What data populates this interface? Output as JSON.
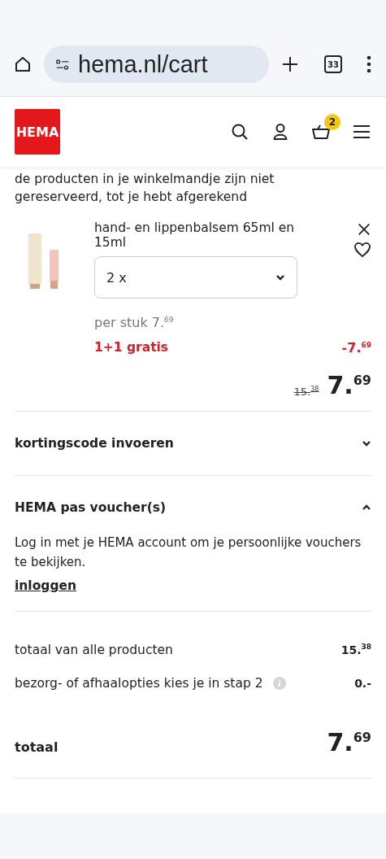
{
  "browser": {
    "url": "hema.nl/cart",
    "tab_count": "33"
  },
  "header": {
    "logo": "HEMA",
    "cart_count": "2"
  },
  "notice": "de producten in je winkelmandje zijn niet gereserveerd, tot je hebt afgerekend",
  "product": {
    "name": "hand- en lippenbalsem 65ml en 15ml",
    "quantity": "2 x",
    "unit_price": "per stuk 7.$^{69}$",
    "promo": "1+1 gratis",
    "discount": "-7.$^{69}$",
    "old_price": "15.$^{38}$",
    "price": "7.$^{69}$"
  },
  "sections": [
    {
      "title": "kortingscode invoeren",
      "expanded": false
    },
    {
      "title": "HEMA pas voucher(s)",
      "expanded": true,
      "text": "Log in met je HEMA account om je persoonlijke vouchers te bekijken.",
      "link": "inloggen"
    }
  ],
  "summary": [
    {
      "label": "totaal van alle producten",
      "value": "15.$^{38}$",
      "info": false
    },
    {
      "label": "bezorg- of afhaalopties kies je in stap 2",
      "value": "0.-",
      "info": true
    }
  ],
  "total": {
    "label": "totaal",
    "value": "7.$^{69}$"
  }
}
